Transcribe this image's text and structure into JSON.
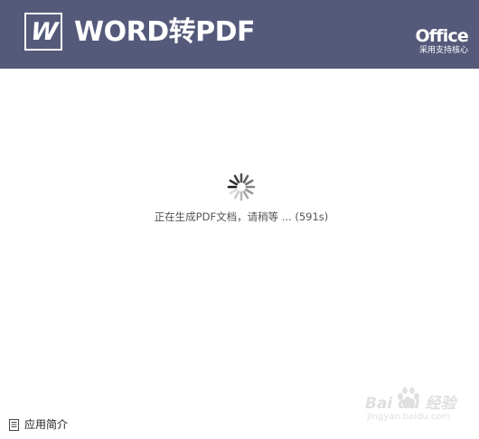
{
  "header": {
    "logo_letter": "W",
    "title": "WORD转PDF",
    "brand_word": "Office",
    "brand_sub": "采用支持核心",
    "background_color": "#555a7b"
  },
  "loading": {
    "spinner_icon": "loading-spinner-icon",
    "status_text": "正在生成PDF文档，请稍等 ... (591s)"
  },
  "footer": {
    "icon": "document-icon",
    "link_label": "应用简介"
  },
  "watermark": {
    "brand": "Bai du 经验",
    "url": "jingyan.baidu.com"
  }
}
